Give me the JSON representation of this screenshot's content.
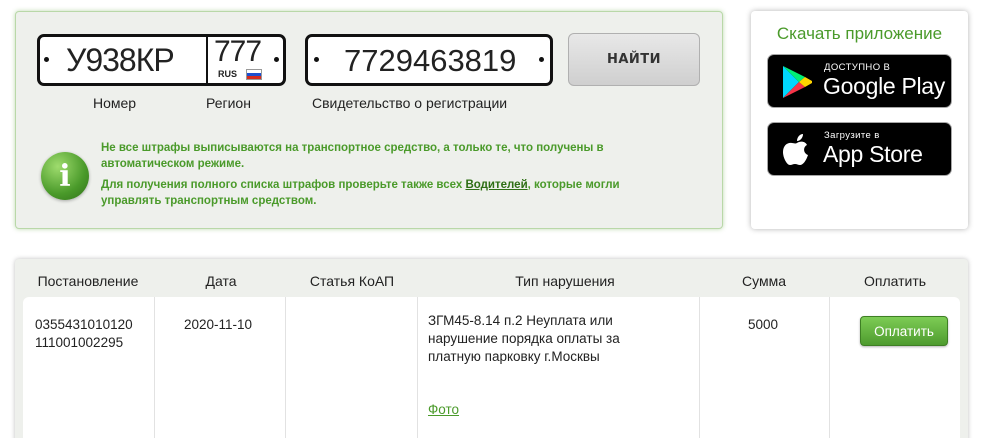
{
  "search": {
    "plate_number": "У938КР",
    "plate_region": "777",
    "plate_country": "RUS",
    "certificate_number": "7729463819",
    "label_number": "Номер",
    "label_region": "Регион",
    "label_certificate": "Свидетельство о регистрации",
    "find_button": "НАЙТИ"
  },
  "info": {
    "line1": "Не все штрафы выписываются на транспортное средство, а только те, что получены в автоматическом режиме.",
    "line2_before": "Для получения полного списка штрафов проверьте также всех ",
    "line2_link": "Водителей",
    "line2_after": ", которые могли управлять транспортным средством."
  },
  "app": {
    "title": "Скачать приложение",
    "google_small": "ДОСТУПНО В",
    "google_big": "Google Play",
    "apple_small": "Загрузите в",
    "apple_big": "App Store"
  },
  "table": {
    "headers": [
      "Постановление",
      "Дата",
      "Статья КоАП",
      "Тип нарушения",
      "Сумма",
      "Оплатить"
    ],
    "rows": [
      {
        "resolution_line1": "0355431010120",
        "resolution_line2": "111001002295",
        "date": "2020-11-10",
        "article": "",
        "violation": "ЗГМ45-8.14 п.2 Неуплата или нарушение порядка оплаты за платную парковку г.Москвы",
        "photo_link": "Фото",
        "amount": "5000",
        "pay_button": "Оплатить"
      }
    ]
  },
  "colors": {
    "accent_green": "#4a9a2a",
    "panel_bg": "#eef0ec"
  }
}
